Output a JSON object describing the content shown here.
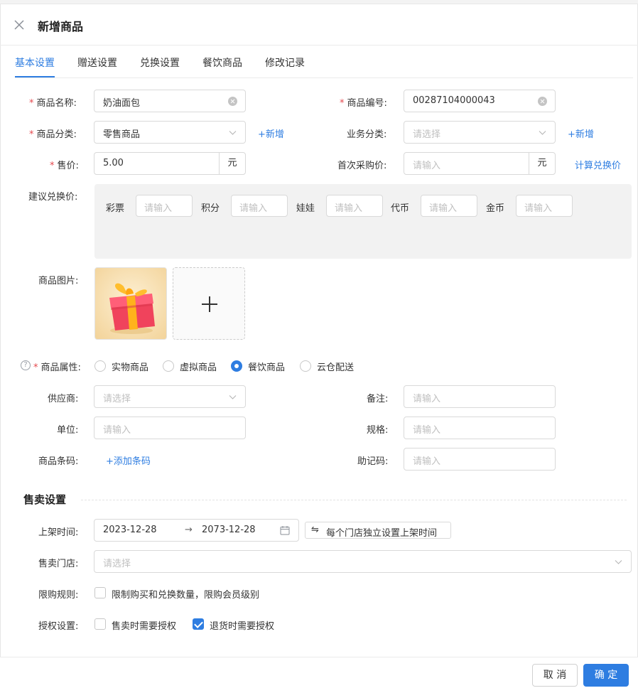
{
  "dialog": {
    "title": "新增商品"
  },
  "tabs": [
    "基本设置",
    "赠送设置",
    "兑换设置",
    "餐饮商品",
    "修改记录"
  ],
  "form": {
    "product_name": {
      "label": "商品名称:",
      "value": "奶油面包"
    },
    "product_code": {
      "label": "商品编号:",
      "value": "00287104000043"
    },
    "category": {
      "label": "商品分类:",
      "value": "零售商品",
      "add_link": "+新增"
    },
    "business_category": {
      "label": "业务分类:",
      "placeholder": "请选择",
      "add_link": "+新增"
    },
    "price": {
      "label": "售价:",
      "value": "5.00",
      "unit": "元"
    },
    "first_purchase_price": {
      "label": "首次采购价:",
      "placeholder": "请输入",
      "unit": "元",
      "link": "计算兑换价"
    },
    "suggested_exchange": {
      "label": "建议兑换价:",
      "items": [
        {
          "name": "彩票",
          "placeholder": "请输入"
        },
        {
          "name": "积分",
          "placeholder": "请输入"
        },
        {
          "name": "娃娃",
          "placeholder": "请输入"
        },
        {
          "name": "代币",
          "placeholder": "请输入"
        },
        {
          "name": "金币",
          "placeholder": "请输入"
        }
      ]
    },
    "product_image": {
      "label": "商品图片:"
    },
    "attribute": {
      "label": "商品属性:",
      "help_glyph": "?",
      "options": [
        "实物商品",
        "虚拟商品",
        "餐饮商品",
        "云仓配送"
      ],
      "selected": "餐饮商品"
    },
    "supplier": {
      "label": "供应商:",
      "placeholder": "请选择"
    },
    "remark": {
      "label": "备注:",
      "placeholder": "请输入"
    },
    "unit": {
      "label": "单位:",
      "placeholder": "请输入"
    },
    "spec": {
      "label": "规格:",
      "placeholder": "请输入"
    },
    "barcode": {
      "label": "商品条码:",
      "add_link": "+添加条码"
    },
    "mnemonic": {
      "label": "助记码:",
      "placeholder": "请输入"
    }
  },
  "sale_settings": {
    "title": "售卖设置",
    "shelf_time": {
      "label": "上架时间:",
      "start": "2023-12-28",
      "arrow": "→",
      "end": "2073-12-28",
      "independent_button": "每个门店独立设置上架时间",
      "swap_glyph": "⇋"
    },
    "stores": {
      "label": "售卖门店:",
      "placeholder": "请选择"
    },
    "limit_rule": {
      "label": "限购规则:",
      "option": "限制购买和兑换数量，限购会员级别",
      "checked": false
    },
    "authorization": {
      "label": "授权设置:",
      "options": [
        {
          "text": "售卖时需要授权",
          "checked": false
        },
        {
          "text": "退货时需要授权",
          "checked": true
        }
      ]
    }
  },
  "footer": {
    "cancel": "取 消",
    "confirm": "确 定"
  },
  "colors": {
    "accent": "#2e7de1",
    "required": "#e5484d",
    "exchange_panel": "#f2f2f2"
  },
  "icons": [
    "close-icon",
    "clear-icon",
    "chevron-down-icon",
    "calendar-icon",
    "help-icon",
    "plus-icon",
    "swap-icon"
  ]
}
